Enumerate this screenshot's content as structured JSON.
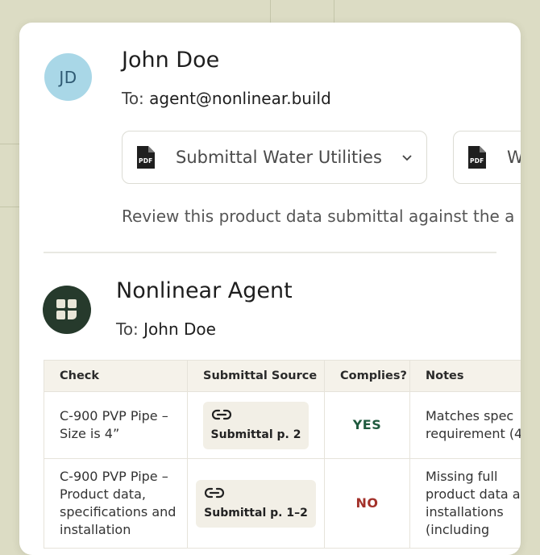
{
  "email": {
    "sender_initials": "JD",
    "sender_name": "John Doe",
    "to_label": "To:",
    "to_value": "agent@nonlinear.build",
    "attachments": [
      {
        "icon": "pdf-file-icon",
        "badge": "PDF",
        "name": "Submittal Water Utilities"
      },
      {
        "icon": "pdf-file-icon",
        "badge": "PDF",
        "name": "W"
      }
    ],
    "body": "Review this product data submittal against the a"
  },
  "reply": {
    "sender_name": "Nonlinear Agent",
    "to_label": "To:",
    "to_value": "John Doe",
    "table": {
      "headers": [
        "Check",
        "Submittal Source",
        "Complies?",
        "Notes"
      ],
      "rows": [
        {
          "check": [
            "C-900 PVP Pipe –",
            "Size is 4”"
          ],
          "source": "Submittal p. 2",
          "complies": "YES",
          "notes": [
            "Matches spec",
            "requirement (4"
          ]
        },
        {
          "check": [
            "C-900 PVP Pipe –",
            "Product data,",
            "specifications and",
            "installation"
          ],
          "source": "Submittal p. 1–2",
          "complies": "NO",
          "notes": [
            "Missing full",
            "product data an",
            "installations",
            "(including"
          ]
        }
      ]
    }
  },
  "colors": {
    "background": "#dcdcc4",
    "yes": "#1f5a3e",
    "no": "#a3312a",
    "agent_avatar": "#263a2c",
    "user_avatar": "#a9d7e7"
  }
}
